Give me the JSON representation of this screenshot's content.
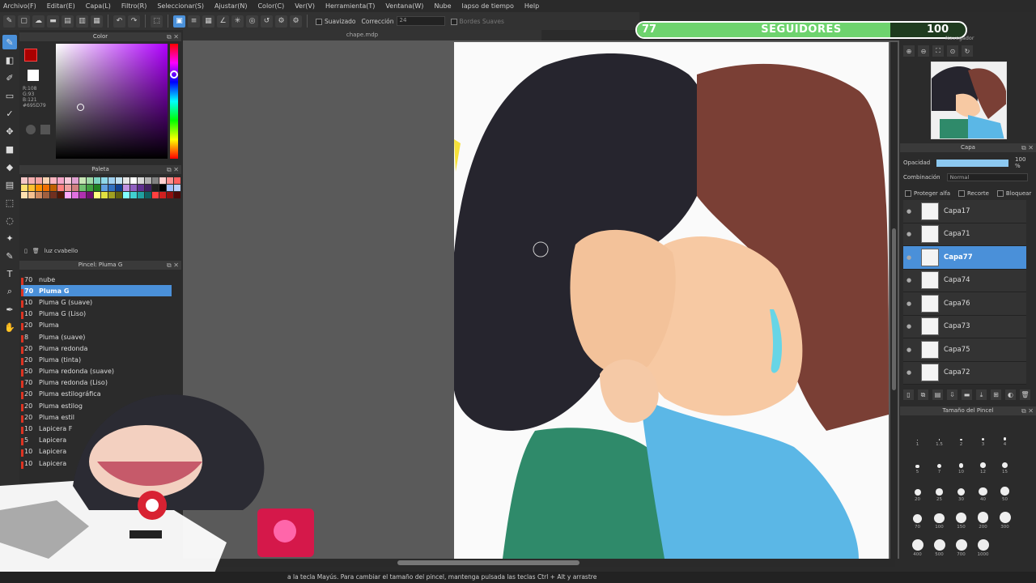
{
  "menu": [
    "Archivo(F)",
    "Editar(E)",
    "Capa(L)",
    "Filtro(R)",
    "Seleccionar(S)",
    "Ajustar(N)",
    "Color(C)",
    "Ver(V)",
    "Herramienta(T)",
    "Ventana(W)",
    "Nube",
    "lapso de tiempo",
    "Help"
  ],
  "toolbar": {
    "smooth_label": "Suavizado",
    "correction_label": "Corrección",
    "correction_value": "24",
    "soft_edges_label": "Bordes Suaves"
  },
  "document": {
    "tab_title": "chape.mdp"
  },
  "color_panel": {
    "title": "Color",
    "values": [
      "R:108",
      "G:93",
      "B:121",
      "#695D79"
    ]
  },
  "palette_panel": {
    "title": "Paleta",
    "palette_name": "luz cvabello",
    "colors": [
      "#f4c6c6",
      "#f6b0b0",
      "#f3a5a5",
      "#f9d2b0",
      "#ffb6c1",
      "#f5a6c8",
      "#f7c8d8",
      "#e0a0d0",
      "#c7e6b5",
      "#9fd9a6",
      "#7bd3c0",
      "#8ed8e8",
      "#a0d0f0",
      "#c0e0f0",
      "#e6e6e6",
      "#ffffff",
      "#d8d8d8",
      "#b0b0b0",
      "#808080",
      "#ffd0d0",
      "#ff9090",
      "#ff6060",
      "#ffe070",
      "#ffc030",
      "#ff9000",
      "#f07000",
      "#c06000",
      "#ff8080",
      "#f0a0a0",
      "#d08080",
      "#70c070",
      "#40a040",
      "#208020",
      "#60a0e0",
      "#3070c0",
      "#104090",
      "#c090e0",
      "#9060c0",
      "#603090",
      "#402060",
      "#202020",
      "#000000",
      "#a0c0ff",
      "#b8d0ff",
      "#ffe0b0",
      "#f5c090",
      "#d08a60",
      "#a06040",
      "#703020",
      "#501808",
      "#ffaaff",
      "#e070e0",
      "#b030b0",
      "#701070",
      "#ffff80",
      "#e0e040",
      "#a0a020",
      "#606010",
      "#80ffff",
      "#40d0d0",
      "#20a0a0",
      "#106060",
      "#ff4040",
      "#d02020",
      "#901010",
      "#500808"
    ]
  },
  "brush_panel": {
    "title": "Pincel: Pluma G",
    "items": [
      {
        "size": "70",
        "name": "nube",
        "selected": false
      },
      {
        "size": "70",
        "name": "Pluma G",
        "selected": true
      },
      {
        "size": "10",
        "name": "Pluma G (suave)",
        "selected": false
      },
      {
        "size": "10",
        "name": "Pluma G (Liso)",
        "selected": false
      },
      {
        "size": "20",
        "name": "Pluma",
        "selected": false
      },
      {
        "size": "8",
        "name": "Pluma (suave)",
        "selected": false
      },
      {
        "size": "20",
        "name": "Pluma redonda",
        "selected": false
      },
      {
        "size": "20",
        "name": "Pluma (tinta)",
        "selected": false
      },
      {
        "size": "50",
        "name": "Pluma redonda (suave)",
        "selected": false
      },
      {
        "size": "70",
        "name": "Pluma redonda (Liso)",
        "selected": false
      },
      {
        "size": "20",
        "name": "Pluma estilográfica",
        "selected": false
      },
      {
        "size": "20",
        "name": "Pluma estilog",
        "selected": false
      },
      {
        "size": "20",
        "name": "Pluma estil",
        "selected": false
      },
      {
        "size": "10",
        "name": "Lapicera F",
        "selected": false
      },
      {
        "size": "5",
        "name": "Lapicera",
        "selected": false
      },
      {
        "size": "10",
        "name": "Lapicera",
        "selected": false
      },
      {
        "size": "10",
        "name": "Lapicera",
        "selected": false
      }
    ]
  },
  "followers": {
    "current": "77",
    "label": "SEGUIDORES",
    "goal": "100",
    "progress_fraction": 0.77
  },
  "navigator": {
    "title": "Navegador"
  },
  "layer_panel": {
    "title": "Capa",
    "opacity_label": "Opacidad",
    "opacity_value": "100 %",
    "blend_label": "Combinación",
    "blend_value": "Normal",
    "protect_alpha": "Proteger alfa",
    "clipping": "Recorte",
    "lock": "Bloquear",
    "layers": [
      {
        "name": "Capa17",
        "selected": false
      },
      {
        "name": "Capa71",
        "selected": false
      },
      {
        "name": "Capa77",
        "selected": true
      },
      {
        "name": "Capa74",
        "selected": false
      },
      {
        "name": "Capa76",
        "selected": false
      },
      {
        "name": "Capa73",
        "selected": false
      },
      {
        "name": "Capa75",
        "selected": false
      },
      {
        "name": "Capa72",
        "selected": false
      }
    ]
  },
  "brush_size_panel": {
    "title": "Tamaño del Pincel",
    "sizes": [
      "1",
      "1.5",
      "2",
      "3",
      "4",
      "5",
      "7",
      "10",
      "12",
      "15",
      "20",
      "25",
      "30",
      "40",
      "50",
      "70",
      "100",
      "150",
      "200",
      "300",
      "400",
      "500",
      "700",
      "1000"
    ]
  },
  "status": {
    "text": "a la tecla Mayús. Para cambiar el tamaño del pincel, mantenga pulsada las teclas Ctrl + Alt y arrastre"
  },
  "colors": {
    "accent": "#4a90d9",
    "progress": "#6ed36e"
  }
}
